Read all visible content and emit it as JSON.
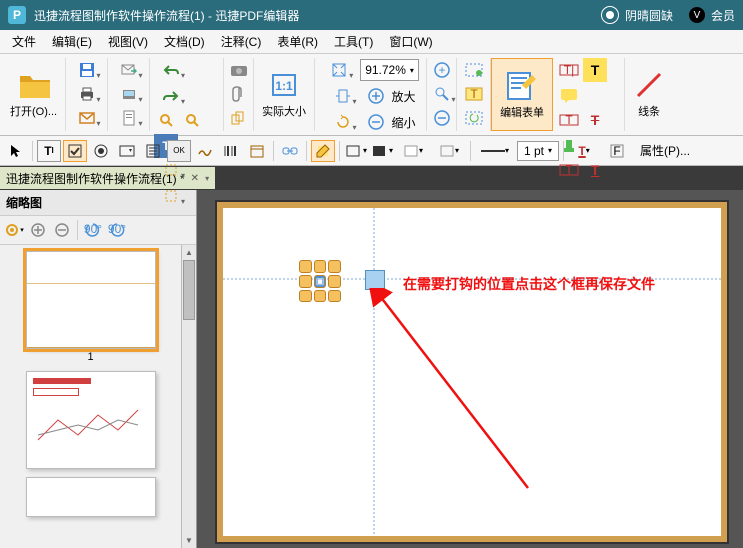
{
  "titlebar": {
    "app_title": "迅捷流程图制作软件操作流程(1)  -  迅捷PDF编辑器",
    "user_name": "阴晴圆缺",
    "vip_label": "会员"
  },
  "menu": {
    "file": "文件",
    "edit": "编辑(E)",
    "view": "视图(V)",
    "document": "文档(D)",
    "comment": "注释(C)",
    "form": "表单(R)",
    "tools": "工具(T)",
    "window": "窗口(W)"
  },
  "ribbon": {
    "open": "打开(O)...",
    "actual_size": "实际大小",
    "zoom_in": "放大",
    "zoom_out": "缩小",
    "zoom_value": "91.72%",
    "edit_form": "编辑表单",
    "lines": "线条"
  },
  "secondbar": {
    "line_weight": "1 pt",
    "props": "属性(P)..."
  },
  "doc_tab": {
    "name": "迅捷流程图制作软件操作流程(1) *"
  },
  "panel": {
    "title": "缩略图",
    "page1": "1"
  },
  "annotation": {
    "text": "在需要打钩的位置点击这个框再保存文件"
  },
  "chart_data": null
}
